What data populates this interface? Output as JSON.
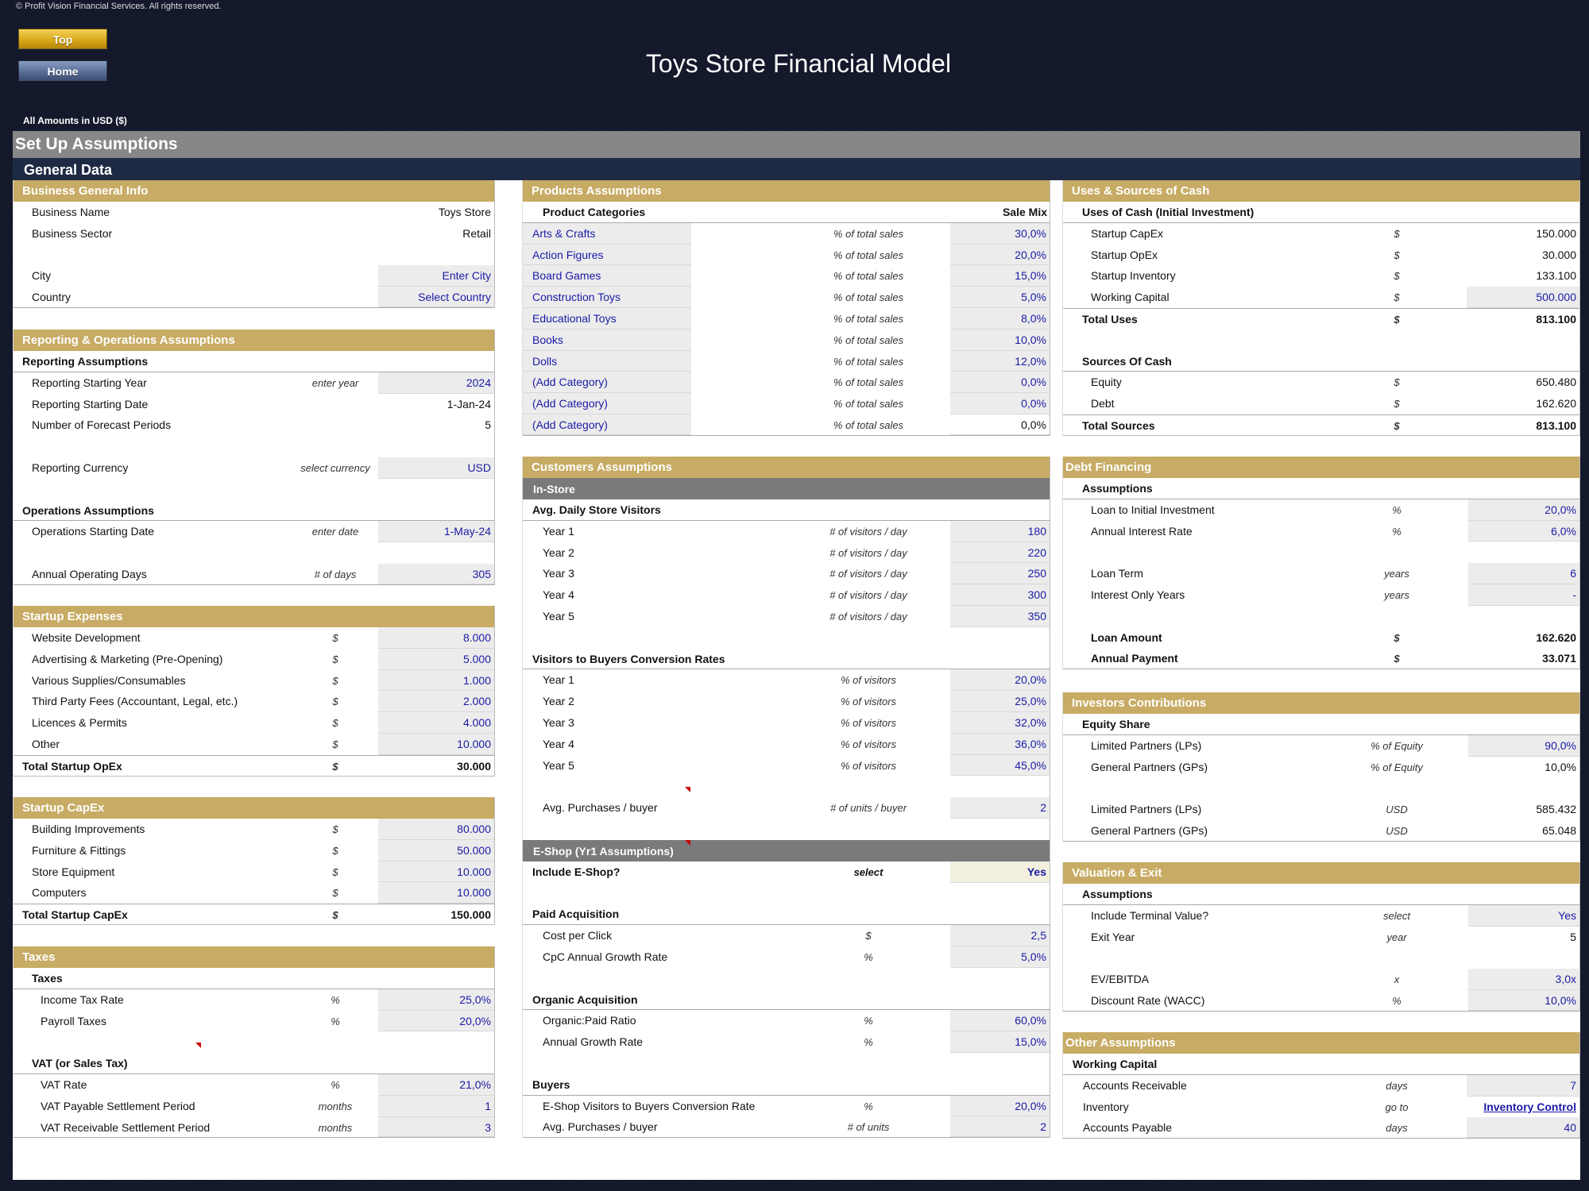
{
  "copyright": "© Profit Vision Financial Services. All rights reserved.",
  "nav": {
    "top_label": "Top",
    "home_label": "Home"
  },
  "title": "Toys Store Financial Model",
  "amounts_note": "All Amounts in  USD ($)",
  "banner": {
    "setup": "Set Up Assumptions",
    "general": "General Data"
  },
  "business_info": {
    "title": "Business General Info",
    "rows": [
      {
        "label": "Business Name",
        "value": "Toys Store"
      },
      {
        "label": "Business Sector",
        "value": "Retail"
      },
      {
        "label": "City",
        "value": "Enter City"
      },
      {
        "label": "Country",
        "value": "Select Country"
      }
    ]
  },
  "reporting": {
    "title": "Reporting & Operations Assumptions",
    "reporting_group": "Reporting Assumptions",
    "starting_year": {
      "label": "Reporting Starting Year",
      "unit": "enter year",
      "value": "2024"
    },
    "starting_date": {
      "label": "Reporting Starting Date",
      "value": "1-Jan-24"
    },
    "forecast_periods": {
      "label": "Number of Forecast Periods",
      "value": "5"
    },
    "currency": {
      "label": "Reporting Currency",
      "unit": "select currency",
      "value": "USD"
    },
    "operations_group": "Operations Assumptions",
    "ops_start": {
      "label": "Operations Starting Date",
      "unit": "enter date",
      "value": "1-May-24"
    },
    "operating_days": {
      "label": "Annual Operating Days",
      "unit": "# of days",
      "value": "305"
    }
  },
  "startup_expenses": {
    "title": "Startup Expenses",
    "rows": [
      {
        "label": "Website Development",
        "unit": "$",
        "value": "8.000"
      },
      {
        "label": "Advertising & Marketing (Pre-Opening)",
        "unit": "$",
        "value": "5.000"
      },
      {
        "label": "Various Supplies/Consumables",
        "unit": "$",
        "value": "1.000"
      },
      {
        "label": "Third Party Fees (Accountant, Legal, etc.)",
        "unit": "$",
        "value": "2.000"
      },
      {
        "label": "Licences & Permits",
        "unit": "$",
        "value": "4.000"
      },
      {
        "label": "Other",
        "unit": "$",
        "value": "10.000"
      }
    ],
    "total": {
      "label": "Total Startup OpEx",
      "unit": "$",
      "value": "30.000"
    }
  },
  "startup_capex": {
    "title": "Startup CapEx",
    "rows": [
      {
        "label": "Building Improvements",
        "unit": "$",
        "value": "80.000"
      },
      {
        "label": "Furniture & Fittings",
        "unit": "$",
        "value": "50.000"
      },
      {
        "label": "Store Equipment",
        "unit": "$",
        "value": "10.000"
      },
      {
        "label": "Computers",
        "unit": "$",
        "value": "10.000"
      }
    ],
    "total": {
      "label": "Total Startup CapEx",
      "unit": "$",
      "value": "150.000"
    }
  },
  "taxes": {
    "title": "Taxes",
    "taxes_group": "Taxes",
    "income_tax": {
      "label": "Income Tax Rate",
      "unit": "%",
      "value": "25,0%"
    },
    "payroll": {
      "label": "Payroll Taxes",
      "unit": "%",
      "value": "20,0%"
    },
    "vat_group": "VAT (or Sales Tax)",
    "vat_rate": {
      "label": "VAT Rate",
      "unit": "%",
      "value": "21,0%"
    },
    "vat_payable": {
      "label": "VAT Payable Settlement Period",
      "unit": "months",
      "value": "1"
    },
    "vat_receivable": {
      "label": "VAT Receivable Settlement Period",
      "unit": "months",
      "value": "3"
    }
  },
  "products": {
    "title": "Products Assumptions",
    "header_left": "Product Categories",
    "header_right": "Sale Mix",
    "unit": "% of total sales",
    "categories": [
      {
        "name": "Arts & Crafts",
        "value": "30,0%"
      },
      {
        "name": "Action Figures",
        "value": "20,0%"
      },
      {
        "name": "Board Games",
        "value": "15,0%"
      },
      {
        "name": "Construction Toys",
        "value": "5,0%"
      },
      {
        "name": "Educational Toys",
        "value": "8,0%"
      },
      {
        "name": "Books",
        "value": "10,0%"
      },
      {
        "name": "Dolls",
        "value": "12,0%"
      },
      {
        "name": "(Add Category)",
        "value": "0,0%"
      },
      {
        "name": "(Add Category)",
        "value": "0,0%"
      },
      {
        "name": "(Add Category)",
        "value": "0,0%"
      }
    ]
  },
  "customers": {
    "title": "Customers Assumptions",
    "instore_label": "In-Store",
    "visitors_group": "Avg. Daily Store Visitors",
    "visitors_unit": "# of visitors / day",
    "visitors": [
      {
        "label": "Year 1",
        "value": "180"
      },
      {
        "label": "Year 2",
        "value": "220"
      },
      {
        "label": "Year 3",
        "value": "250"
      },
      {
        "label": "Year 4",
        "value": "300"
      },
      {
        "label": "Year 5",
        "value": "350"
      }
    ],
    "conversion_group": "Visitors to Buyers Conversion Rates",
    "conversion_unit": "% of visitors",
    "conversion": [
      {
        "label": "Year 1",
        "value": "20,0%"
      },
      {
        "label": "Year 2",
        "value": "25,0%"
      },
      {
        "label": "Year 3",
        "value": "32,0%"
      },
      {
        "label": "Year 4",
        "value": "36,0%"
      },
      {
        "label": "Year 5",
        "value": "45,0%"
      }
    ],
    "avg_purchases": {
      "label": "Avg. Purchases / buyer",
      "unit": "# of units / buyer",
      "value": "2"
    },
    "eshop_label": "E-Shop (Yr1 Assumptions)",
    "include_eshop": {
      "label": "Include E-Shop?",
      "unit": "select",
      "value": "Yes"
    },
    "paid_group": "Paid Acquisition",
    "cpc": {
      "label": "Cost per Click",
      "unit": "$",
      "value": "2,5"
    },
    "cpc_growth": {
      "label": "CpC Annual Growth Rate",
      "unit": "%",
      "value": "5,0%"
    },
    "organic_group": "Organic Acquisition",
    "organic_ratio": {
      "label": "Organic:Paid Ratio",
      "unit": "%",
      "value": "60,0%"
    },
    "organic_growth": {
      "label": "Annual Growth Rate",
      "unit": "%",
      "value": "15,0%"
    },
    "buyers_group": "Buyers",
    "eshop_conversion": {
      "label": "E-Shop Visitors to Buyers Conversion Rate",
      "unit": "%",
      "value": "20,0%"
    },
    "eshop_purchases": {
      "label": "Avg. Purchases / buyer",
      "unit": "# of units",
      "value": "2"
    }
  },
  "uses_sources": {
    "title": "Uses & Sources of Cash",
    "uses_group": "Uses of Cash (Initial Investment)",
    "uses": [
      {
        "label": "Startup CapEx",
        "unit": "$",
        "value": "150.000"
      },
      {
        "label": "Startup OpEx",
        "unit": "$",
        "value": "30.000"
      },
      {
        "label": "Startup Inventory",
        "unit": "$",
        "value": "133.100"
      },
      {
        "label": "Working Capital",
        "unit": "$",
        "value": "500.000"
      }
    ],
    "total_uses": {
      "label": "Total Uses",
      "unit": "$",
      "value": "813.100"
    },
    "sources_group": "Sources Of Cash",
    "sources": [
      {
        "label": "Equity",
        "unit": "$",
        "value": "650.480"
      },
      {
        "label": "Debt",
        "unit": "$",
        "value": "162.620"
      }
    ],
    "total_sources": {
      "label": "Total Sources",
      "unit": "$",
      "value": "813.100"
    }
  },
  "debt": {
    "title": "Debt Financing",
    "group": "Assumptions",
    "loan_to_investment": {
      "label": "Loan to Initial Investment",
      "unit": "%",
      "value": "20,0%"
    },
    "interest_rate": {
      "label": "Annual Interest Rate",
      "unit": "%",
      "value": "6,0%"
    },
    "loan_term": {
      "label": "Loan Term",
      "unit": "years",
      "value": "6"
    },
    "interest_only": {
      "label": "Interest Only Years",
      "unit": "years",
      "value": "-"
    },
    "loan_amount": {
      "label": "Loan Amount",
      "unit": "$",
      "value": "162.620"
    },
    "annual_payment": {
      "label": "Annual Payment",
      "unit": "$",
      "value": "33.071"
    }
  },
  "investors": {
    "title": "Investors Contributions",
    "group": "Equity Share",
    "lp_pct": {
      "label": "Limited Partners (LPs)",
      "unit": "% of Equity",
      "value": "90,0%"
    },
    "gp_pct": {
      "label": "General Partners (GPs)",
      "unit": "% of Equity",
      "value": "10,0%"
    },
    "lp_usd": {
      "label": "Limited Partners (LPs)",
      "unit": "USD",
      "value": "585.432"
    },
    "gp_usd": {
      "label": "General Partners (GPs)",
      "unit": "USD",
      "value": "65.048"
    }
  },
  "valuation": {
    "title": "Valuation & Exit",
    "group": "Assumptions",
    "terminal": {
      "label": "Include Terminal Value?",
      "unit": "select",
      "value": "Yes"
    },
    "exit_year": {
      "label": "Exit Year",
      "unit": "year",
      "value": "5"
    },
    "ev_ebitda": {
      "label": "EV/EBITDA",
      "unit": "x",
      "value": "3,0x"
    },
    "wacc": {
      "label": "Discount Rate (WACC)",
      "unit": "%",
      "value": "10,0%"
    }
  },
  "other": {
    "title": "Other Assumptions",
    "group": "Working Capital",
    "ar": {
      "label": "Accounts Receivable",
      "unit": "days",
      "value": "7"
    },
    "inventory": {
      "label": "Inventory",
      "unit": "go to",
      "value": "Inventory Control"
    },
    "ap": {
      "label": "Accounts Payable",
      "unit": "days",
      "value": "40"
    }
  }
}
